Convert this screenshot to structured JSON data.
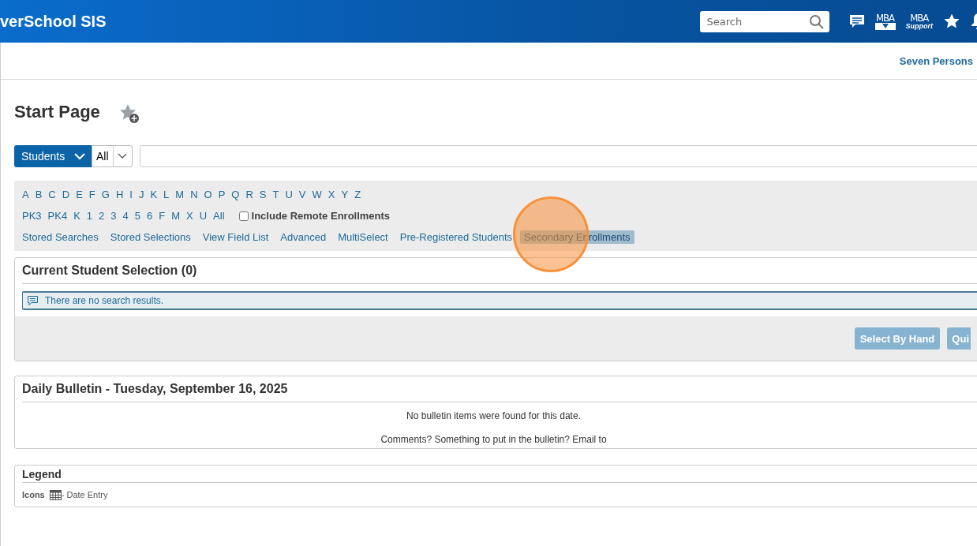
{
  "header": {
    "app_title": "verSchool SIS",
    "search": {
      "placeholder": "Search"
    },
    "mba_download": {
      "label": "MBA"
    },
    "mba_support": {
      "label": "MBA",
      "sublabel": "Support"
    }
  },
  "subheader": {
    "school": "Seven Persons"
  },
  "page_title": "Start Page",
  "search_bar": {
    "type": "Students",
    "scope": "All"
  },
  "letters": [
    "A",
    "B",
    "C",
    "D",
    "E",
    "F",
    "G",
    "H",
    "I",
    "J",
    "K",
    "L",
    "M",
    "N",
    "O",
    "P",
    "Q",
    "R",
    "S",
    "T",
    "U",
    "V",
    "W",
    "X",
    "Y",
    "Z"
  ],
  "grades": [
    "PK3",
    "PK4",
    "K",
    "1",
    "2",
    "3",
    "4",
    "5",
    "6",
    "F",
    "M",
    "X",
    "U",
    "All"
  ],
  "include_remote": {
    "label": "Include Remote Enrollments",
    "checked": false
  },
  "search_links": [
    {
      "label": "Stored Searches",
      "selected": false
    },
    {
      "label": "Stored Selections",
      "selected": false
    },
    {
      "label": "View Field List",
      "selected": false
    },
    {
      "label": "Advanced",
      "selected": false
    },
    {
      "label": "MultiSelect",
      "selected": false
    },
    {
      "label": "Pre-Registered Students",
      "selected": false
    },
    {
      "label": "Secondary Enrollments",
      "selected": true
    }
  ],
  "click_marker": {
    "kind": "highlight"
  },
  "selection": {
    "title": "Current Student Selection (0)",
    "message": "There are no search results.",
    "buttons": [
      "Select By Hand",
      "Qui"
    ]
  },
  "bulletin": {
    "title": "Daily Bulletin - Tuesday, September 16, 2025",
    "lines": [
      "No bulletin items were found for this date.",
      "Comments? Something to put in the bulletin? Email to"
    ]
  },
  "legend": {
    "title": "Legend",
    "label": "Icons",
    "entry": "- Date Entry"
  }
}
